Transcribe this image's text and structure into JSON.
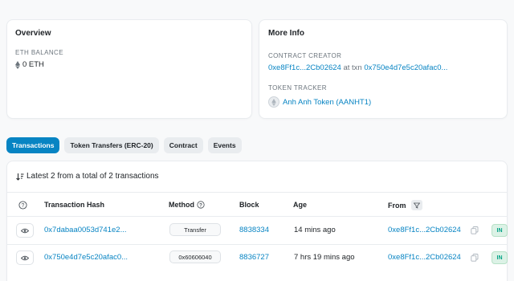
{
  "overview": {
    "title": "Overview",
    "eth_balance_label": "ETH BALANCE",
    "eth_balance_value": "0 ETH"
  },
  "more_info": {
    "title": "More Info",
    "contract_creator_label": "CONTRACT CREATOR",
    "creator_address": "0xe8Ff1c...2Cb02624",
    "at_txn_text": "at txn",
    "creator_txn": "0x750e4d7e5c20afac0...",
    "token_tracker_label": "TOKEN TRACKER",
    "token_name": "Anh Anh Token (AANHT1)"
  },
  "tabs": [
    {
      "label": "Transactions",
      "active": true
    },
    {
      "label": "Token Transfers (ERC-20)",
      "active": false
    },
    {
      "label": "Contract",
      "active": false
    },
    {
      "label": "Events",
      "active": false
    }
  ],
  "transactions": {
    "summary": "Latest 2 from a total of 2 transactions",
    "columns": {
      "hash": "Transaction Hash",
      "method": "Method",
      "block": "Block",
      "age": "Age",
      "from": "From"
    },
    "rows": [
      {
        "hash": "0x7dabaa0053d741e2...",
        "method": "Transfer",
        "block": "8838334",
        "age": "14 mins ago",
        "from": "0xe8Ff1c...2Cb02624",
        "direction": "IN"
      },
      {
        "hash": "0x750e4d7e5c20afac0...",
        "method": "0x60606040",
        "block": "8836727",
        "age": "7 hrs 19 mins ago",
        "from": "0xe8Ff1c...2Cb02624",
        "direction": "IN"
      }
    ]
  },
  "colors": {
    "accent": "#0784c3",
    "in_badge_text": "#00a186",
    "in_badge_bg": "#dcf2e6"
  }
}
